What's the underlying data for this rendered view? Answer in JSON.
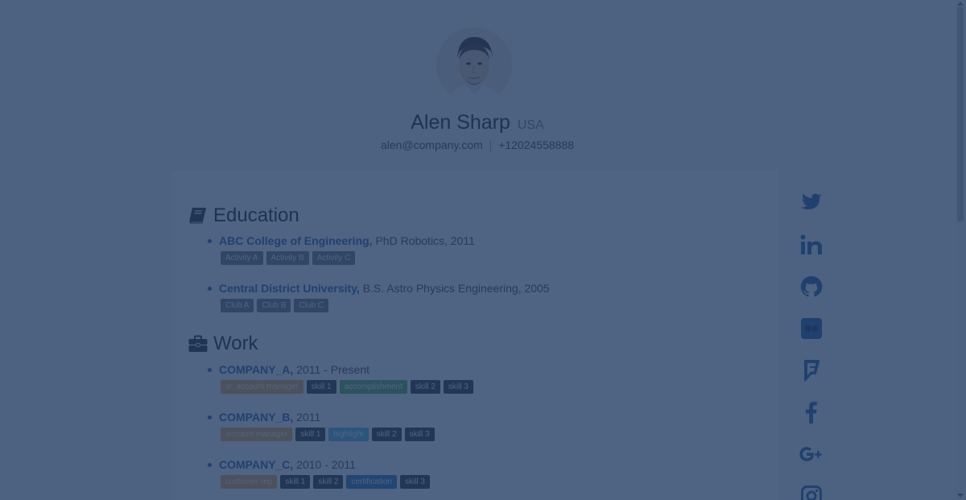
{
  "profile": {
    "name": "Alen Sharp",
    "country": "USA",
    "email": "alen@company.com",
    "separator": "|",
    "phone": "+12024558888"
  },
  "education": {
    "title": "Education",
    "icon": "book-icon",
    "entries": [
      {
        "org": "ABC College of Engineering,",
        "detail": " PhD Robotics, 2011",
        "tags": [
          {
            "label": "Activity A",
            "color": "#777777"
          },
          {
            "label": "Activity B",
            "color": "#777777"
          },
          {
            "label": "Activity C",
            "color": "#777777"
          }
        ]
      },
      {
        "org": "Central District University,",
        "detail": " B.S. Astro Physics Engineering, 2005",
        "tags": [
          {
            "label": "Club A",
            "color": "#777777"
          },
          {
            "label": "Club B",
            "color": "#777777"
          },
          {
            "label": "Club C",
            "color": "#777777"
          }
        ]
      }
    ]
  },
  "work": {
    "title": "Work",
    "icon": "briefcase-icon",
    "entries": [
      {
        "org": "COMPANY_A,",
        "detail": " 2011 - Present",
        "tags": [
          {
            "label": "sr. account manager",
            "color": "#f0ad4e"
          },
          {
            "label": "skill 1",
            "color": "#333333"
          },
          {
            "label": "accomplishment",
            "color": "#5cb85c"
          },
          {
            "label": "skill 2",
            "color": "#333333"
          },
          {
            "label": "skill 3",
            "color": "#333333"
          }
        ]
      },
      {
        "org": "COMPANY_B,",
        "detail": " 2011",
        "tags": [
          {
            "label": "account manager",
            "color": "#f0ad4e"
          },
          {
            "label": "skill 1",
            "color": "#333333"
          },
          {
            "label": "highlight",
            "color": "#5bc0de"
          },
          {
            "label": "skill 2",
            "color": "#333333"
          },
          {
            "label": "skill 3",
            "color": "#333333"
          }
        ]
      },
      {
        "org": "COMPANY_C,",
        "detail": " 2010 - 2011",
        "tags": [
          {
            "label": "customer rep",
            "color": "#f0ad4e"
          },
          {
            "label": "skill 1",
            "color": "#333333"
          },
          {
            "label": "skill 2",
            "color": "#333333"
          },
          {
            "label": "certification",
            "color": "#337ab7"
          },
          {
            "label": "skill 3",
            "color": "#333333"
          }
        ]
      }
    ]
  },
  "social": [
    "twitter-icon",
    "linkedin-icon",
    "github-icon",
    "flickr-icon",
    "foursquare-icon",
    "facebook-icon",
    "google-plus-icon",
    "instagram-icon"
  ],
  "colors": {
    "link": "#2a64a8",
    "overlay": "#1e375f",
    "social_icon": "#2a64a8"
  }
}
